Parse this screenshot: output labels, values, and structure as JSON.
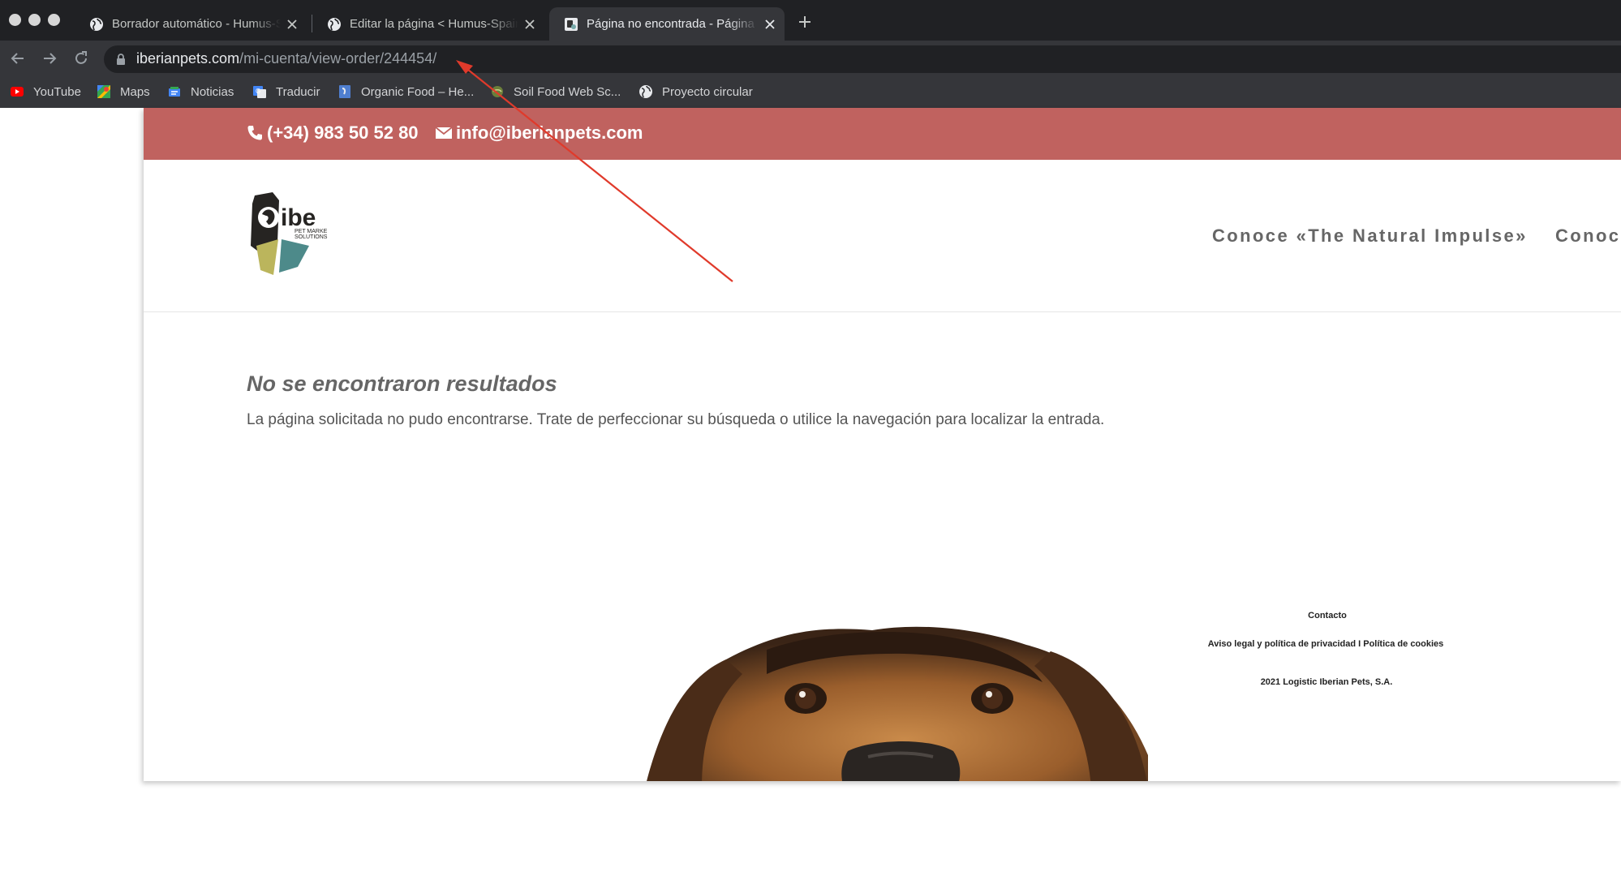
{
  "browser": {
    "tabs": [
      {
        "title": "Borrador automático - Humus-Spain",
        "active": false
      },
      {
        "title": "Editar la página < Humus-Spain",
        "active": false
      },
      {
        "title": "Página no encontrada - Página",
        "active": true
      }
    ],
    "address": {
      "domain": "iberianpets.com",
      "path": "/mi-cuenta/view-order/244454/"
    },
    "bookmarks": [
      {
        "label": "YouTube",
        "icon": "youtube-icon"
      },
      {
        "label": "Maps",
        "icon": "maps-icon"
      },
      {
        "label": "Noticias",
        "icon": "news-icon"
      },
      {
        "label": "Traducir",
        "icon": "translate-icon"
      },
      {
        "label": "Organic Food – He...",
        "icon": "bookmark-page-icon"
      },
      {
        "label": "Soil Food Web Sc...",
        "icon": "soil-icon"
      },
      {
        "label": "Proyecto circular",
        "icon": "globe-icon"
      }
    ]
  },
  "site": {
    "topbar": {
      "phone": "(+34) 983 50 52 80",
      "email": "info@iberianpets.com",
      "color": "#c0625f"
    },
    "logo": {
      "text": "ibe",
      "subtitle_line1": "PET MARKE",
      "subtitle_line2": "SOLUTIONS"
    },
    "nav": [
      {
        "label": "Conoce «The Natural Impulse»"
      },
      {
        "label": "Conoc"
      }
    ],
    "content": {
      "heading": "No se encontraron resultados",
      "message": "La página solicitada no pudo encontrarse. Trate de perfeccionar su búsqueda o utilice la navegación para localizar la entrada."
    },
    "footer": {
      "contact": "Contacto",
      "legal": "Aviso legal y política de privacidad I Política de cookies",
      "copyright": "2021 Logistic Iberian Pets, S.A."
    }
  },
  "annotation": {
    "type": "arrow",
    "color": "#e03a2b"
  }
}
